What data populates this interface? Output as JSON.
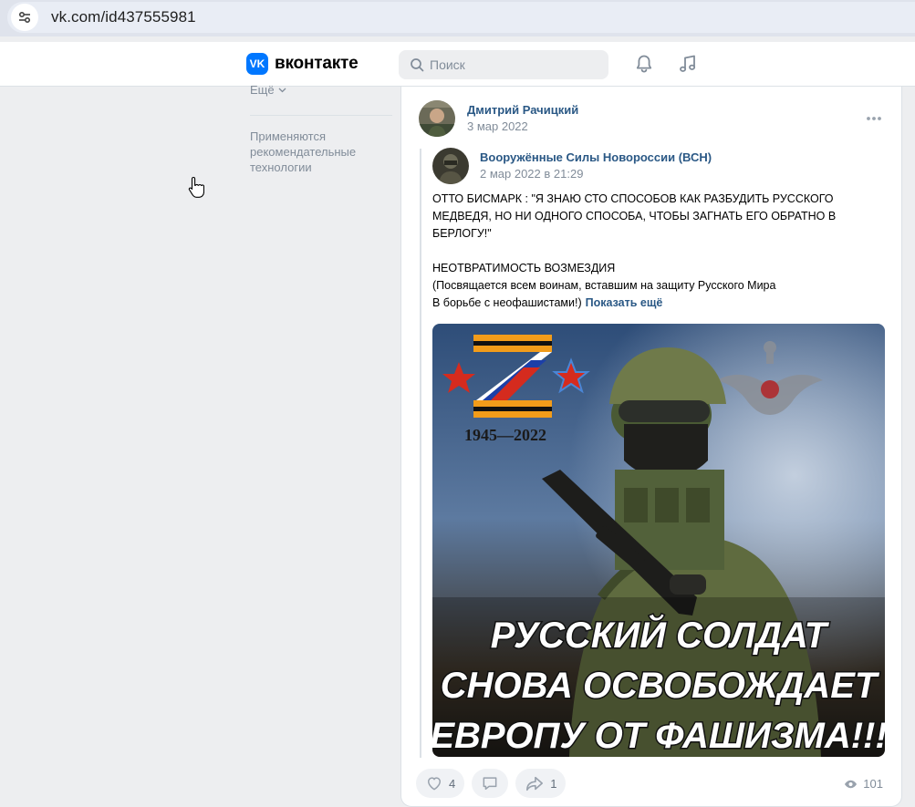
{
  "browser": {
    "url": "vk.com/id437555981"
  },
  "header": {
    "logo_mark": "VK",
    "logo_text": "вконтакте",
    "search_placeholder": "Поиск"
  },
  "sidebar": {
    "more_label": "Ещё",
    "note": "Применяются рекомендательные технологии"
  },
  "post": {
    "author": "Дмитрий Рачицкий",
    "date": "3 мар 2022",
    "repost": {
      "source": "Вооружённые Силы Новороссии (ВСН)",
      "date": "2 мар 2022 в 21:29",
      "text_lines": [
        "ОТТО БИСМАРК : \"Я ЗНАЮ СТО СПОСОБОВ КАК РАЗБУДИТЬ РУССКОГО",
        "МЕДВЕДЯ, НО НИ ОДНОГО СПОСОБА, ЧТОБЫ ЗАГНАТЬ ЕГО ОБРАТНО В",
        "БЕРЛОГУ!\"",
        "",
        "НЕОТВРАТИМОСТЬ ВОЗМЕЗДИЯ",
        "(Посвящается всем воинам, вставшим на защиту Русского Мира",
        "В борьбе с неофашистами!)"
      ],
      "show_more": "Показать ещё",
      "image": {
        "years": "1945—2022",
        "caption_lines": [
          "РУССКИЙ СОЛДАТ",
          "СНОВА ОСВОБОЖДАЕТ",
          "ЕВРОПУ ОТ ФАШИЗМА!!!"
        ]
      }
    },
    "likes": "4",
    "shares": "1",
    "views": "101"
  },
  "colors": {
    "link": "#2a5885",
    "accent": "#0077ff",
    "muted": "#818c99"
  }
}
